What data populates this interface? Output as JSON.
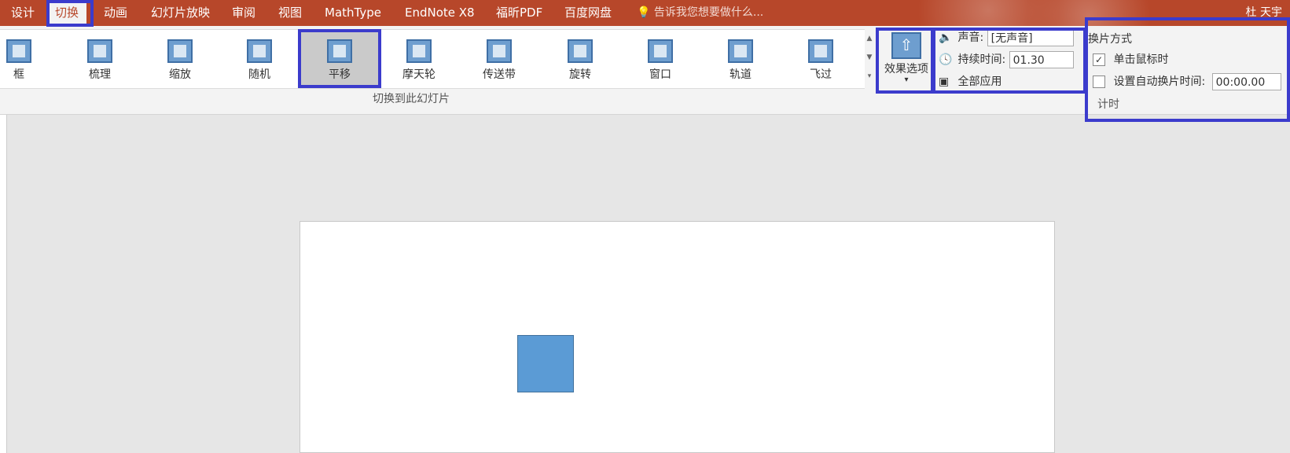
{
  "menu": {
    "items": [
      {
        "label": "设计"
      },
      {
        "label": "切换"
      },
      {
        "label": "动画"
      },
      {
        "label": "幻灯片放映"
      },
      {
        "label": "审阅"
      },
      {
        "label": "视图"
      },
      {
        "label": "MathType"
      },
      {
        "label": "EndNote X8"
      },
      {
        "label": "福昕PDF"
      },
      {
        "label": "百度网盘"
      }
    ],
    "active": "切换",
    "tell_me": "告诉我您想要做什么...",
    "user": "杜 天宇"
  },
  "transitions": {
    "items": [
      {
        "label": "框",
        "icon": "box-transition-icon"
      },
      {
        "label": "梳理",
        "icon": "comb-transition-icon"
      },
      {
        "label": "缩放",
        "icon": "zoom-transition-icon"
      },
      {
        "label": "随机",
        "icon": "random-transition-icon"
      },
      {
        "label": "平移",
        "icon": "pan-transition-icon"
      },
      {
        "label": "摩天轮",
        "icon": "ferris-wheel-transition-icon"
      },
      {
        "label": "传送带",
        "icon": "conveyor-transition-icon"
      },
      {
        "label": "旋转",
        "icon": "rotate-transition-icon"
      },
      {
        "label": "窗口",
        "icon": "window-transition-icon"
      },
      {
        "label": "轨道",
        "icon": "orbit-transition-icon"
      },
      {
        "label": "飞过",
        "icon": "fly-through-transition-icon"
      }
    ],
    "selected": "平移",
    "group_label": "切换到此幻灯片"
  },
  "effect_options": {
    "label": "效果选项",
    "dropdown": "▾"
  },
  "timing": {
    "sound_label": "声音:",
    "sound_value": "[无声音]",
    "duration_label": "持续时间:",
    "duration_value": "01.30",
    "apply_all": "全部应用",
    "advance_title": "换片方式",
    "on_click": "单击鼠标时",
    "on_click_checked": true,
    "after_label": "设置自动换片时间:",
    "after_value": "00:00.00",
    "after_checked": false,
    "group_label": "计时"
  },
  "colors": {
    "accent": "#b7472a",
    "highlight": "#3b3bcc",
    "shape_fill": "#5b9bd5"
  }
}
